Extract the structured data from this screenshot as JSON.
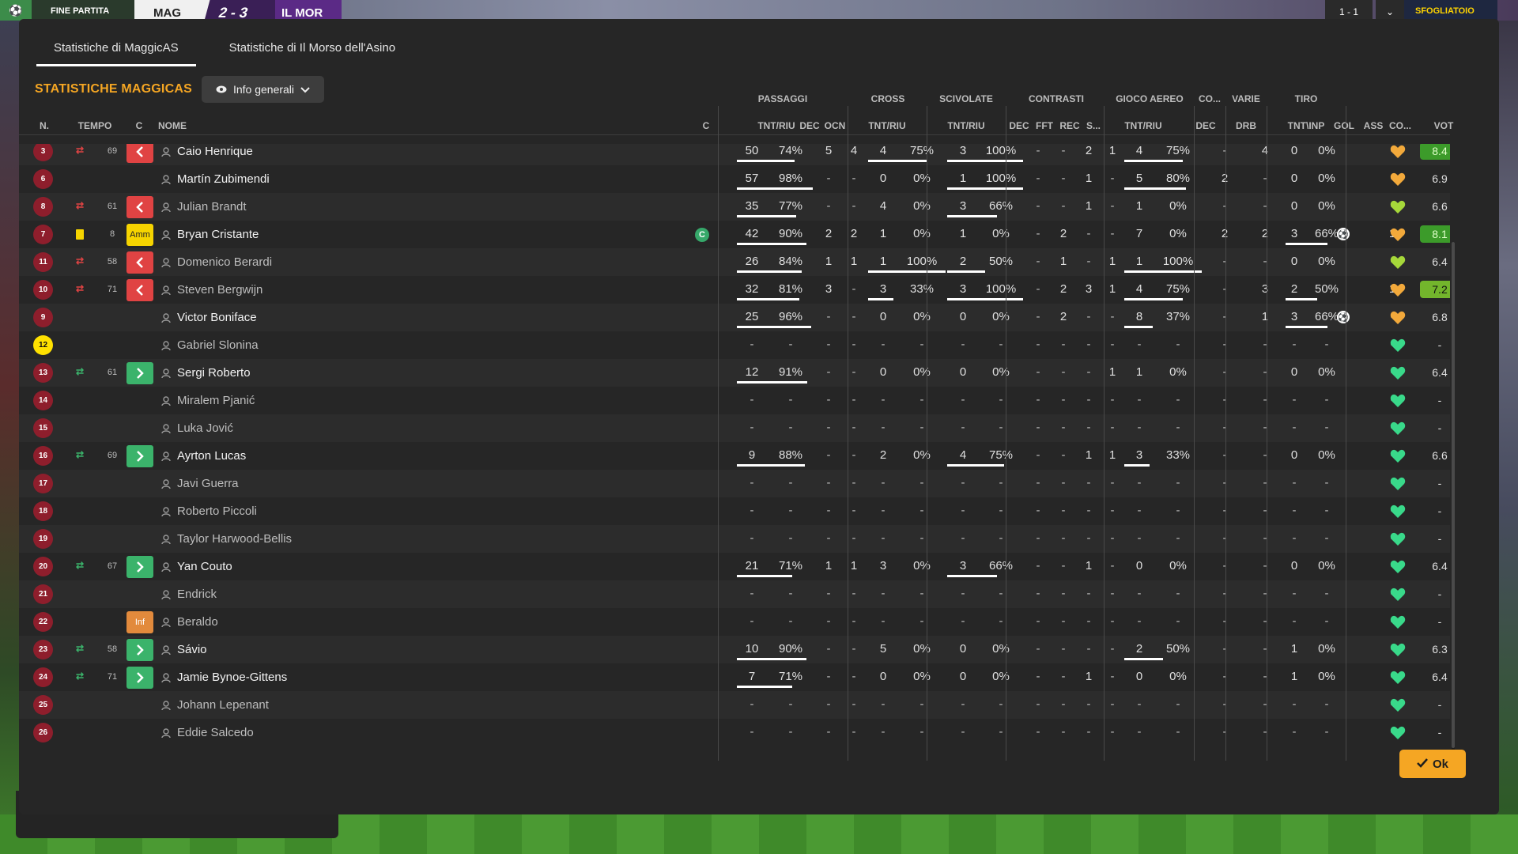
{
  "topbar": {
    "fine_partita": "FINE PARTITA",
    "home_abbr": "MAG",
    "score": "2 - 3",
    "away_abbr": "IL MOR",
    "right_score": "1 - 1",
    "right_label": "SFOGLIATOIO"
  },
  "tabs": [
    {
      "label": "Statistiche di MaggicAS",
      "active": true
    },
    {
      "label": "Statistiche di Il Morso dell'Asino",
      "active": false
    }
  ],
  "title": "STATISTICHE MAGGICAS",
  "view_dropdown": "Info generali",
  "group_headers": {
    "passaggi": "PASSAGGI",
    "cross": "CROSS",
    "scivolate": "SCIVOLATE",
    "contrasti": "CONTRASTI",
    "gioco_aereo": "GIOCO AEREO",
    "co": "CO...",
    "varie": "VARIE",
    "tiro": "TIRO"
  },
  "columns": {
    "n": "N.",
    "tempo": "TEMPO",
    "c": "C",
    "nome": "NOME",
    "capt": "C",
    "pass_tntriu": "TNT/RIU",
    "pass_dec": "DEC",
    "pass_ocn": "OCN",
    "cross_tntriu": "TNT/RIU",
    "sciv_tntriu": "TNT/RIU",
    "contr_dec": "DEC",
    "contr_fft": "FFT",
    "contr_rec": "REC",
    "contr_s": "S...",
    "aereo_tntriu": "TNT/RIU",
    "co_dec": "DEC",
    "varie_drb": "DRB",
    "tiro_tntinp": "TNT\\INP",
    "gol": "GOL",
    "ass": "ASS",
    "co": "CO...",
    "vot": "VOT"
  },
  "players": [
    {
      "n": "3",
      "sub": "out",
      "min": "69",
      "cond": "out",
      "name": "Caio Henrique",
      "played": true,
      "pass": [
        "50",
        "74%"
      ],
      "pdec": "5",
      "pocn": "4",
      "cross": [
        "4",
        "75%"
      ],
      "sciv": [
        "3",
        "100%"
      ],
      "cdec": "-",
      "cfft": "-",
      "crec": "2",
      "cs": "1",
      "aereo": [
        "4",
        "75%"
      ],
      "codec": "-",
      "drb": "4",
      "tiro": [
        "0",
        "0%"
      ],
      "gol": "",
      "ass": "-",
      "heart": "orange",
      "vote": "8.4",
      "vote_style": "hi"
    },
    {
      "n": "6",
      "sub": "",
      "min": "",
      "cond": "",
      "name": "Martín Zubimendi",
      "played": true,
      "pass": [
        "57",
        "98%"
      ],
      "pdec": "-",
      "pocn": "-",
      "cross": [
        "0",
        "0%"
      ],
      "sciv": [
        "1",
        "100%"
      ],
      "cdec": "-",
      "cfft": "-",
      "crec": "1",
      "cs": "-",
      "aereo": [
        "5",
        "80%"
      ],
      "codec": "2",
      "drb": "-",
      "tiro": [
        "0",
        "0%"
      ],
      "gol": "",
      "ass": "-",
      "heart": "orange",
      "vote": "6.9",
      "vote_style": ""
    },
    {
      "n": "8",
      "sub": "out",
      "min": "61",
      "cond": "out",
      "name": "Julian Brandt",
      "played": false,
      "pass": [
        "35",
        "77%"
      ],
      "pdec": "-",
      "pocn": "-",
      "cross": [
        "4",
        "0%"
      ],
      "sciv": [
        "3",
        "66%"
      ],
      "cdec": "-",
      "cfft": "-",
      "crec": "1",
      "cs": "-",
      "aereo": [
        "1",
        "0%"
      ],
      "codec": "-",
      "drb": "-",
      "tiro": [
        "0",
        "0%"
      ],
      "gol": "",
      "ass": "-",
      "heart": "lime",
      "vote": "6.6",
      "vote_style": ""
    },
    {
      "n": "7",
      "sub": "yc",
      "min": "8",
      "cond": "amm",
      "name": "Bryan Cristante",
      "played": true,
      "capt": "C",
      "pass": [
        "42",
        "90%"
      ],
      "pdec": "2",
      "pocn": "2",
      "cross": [
        "1",
        "0%"
      ],
      "sciv": [
        "1",
        "0%"
      ],
      "cdec": "-",
      "cfft": "2",
      "crec": "-",
      "cs": "-",
      "aereo": [
        "7",
        "0%"
      ],
      "codec": "2",
      "drb": "2",
      "tiro": [
        "3",
        "66%"
      ],
      "gol": "1",
      "ass": "1",
      "heart": "orange",
      "vote": "8.1",
      "vote_style": "hi"
    },
    {
      "n": "11",
      "sub": "out",
      "min": "58",
      "cond": "out",
      "name": "Domenico Berardi",
      "played": false,
      "pass": [
        "26",
        "84%"
      ],
      "pdec": "1",
      "pocn": "1",
      "cross": [
        "1",
        "100%"
      ],
      "sciv": [
        "2",
        "50%"
      ],
      "cdec": "-",
      "cfft": "1",
      "crec": "-",
      "cs": "1",
      "aereo": [
        "1",
        "100%"
      ],
      "codec": "-",
      "drb": "-",
      "tiro": [
        "0",
        "0%"
      ],
      "gol": "",
      "ass": "-",
      "heart": "lime",
      "vote": "6.4",
      "vote_style": ""
    },
    {
      "n": "10",
      "sub": "out",
      "min": "71",
      "cond": "out",
      "name": "Steven Bergwijn",
      "played": false,
      "pass": [
        "32",
        "81%"
      ],
      "pdec": "3",
      "pocn": "-",
      "cross": [
        "3",
        "33%"
      ],
      "sciv": [
        "3",
        "100%"
      ],
      "cdec": "-",
      "cfft": "2",
      "crec": "3",
      "cs": "1",
      "aereo": [
        "4",
        "75%"
      ],
      "codec": "-",
      "drb": "3",
      "tiro": [
        "2",
        "50%"
      ],
      "gol": "",
      "ass": "1",
      "heart": "orange",
      "vote": "7.2",
      "vote_style": "mid"
    },
    {
      "n": "9",
      "sub": "",
      "min": "",
      "cond": "",
      "name": "Victor Boniface",
      "played": true,
      "pass": [
        "25",
        "96%"
      ],
      "pdec": "-",
      "pocn": "-",
      "cross": [
        "0",
        "0%"
      ],
      "sciv": [
        "0",
        "0%"
      ],
      "cdec": "-",
      "cfft": "2",
      "crec": "-",
      "cs": "-",
      "aereo": [
        "8",
        "37%"
      ],
      "codec": "-",
      "drb": "1",
      "tiro": [
        "3",
        "66%"
      ],
      "gol": "1",
      "ass": "-",
      "heart": "orange",
      "vote": "6.8",
      "vote_style": ""
    },
    {
      "n": "12",
      "sub": "",
      "min": "",
      "cond": "",
      "name": "Gabriel Slonina",
      "played": false,
      "gk": true,
      "pass": [
        "-",
        "-"
      ],
      "pdec": "-",
      "pocn": "-",
      "cross": [
        "-",
        "-"
      ],
      "sciv": [
        "-",
        "-"
      ],
      "cdec": "-",
      "cfft": "-",
      "crec": "-",
      "cs": "-",
      "aereo": [
        "-",
        "-"
      ],
      "codec": "-",
      "drb": "-",
      "tiro": [
        "-",
        "-"
      ],
      "gol": "",
      "ass": "-",
      "heart": "green",
      "vote": "-",
      "vote_style": ""
    },
    {
      "n": "13",
      "sub": "in",
      "min": "61",
      "cond": "in",
      "name": "Sergi Roberto",
      "played": true,
      "pass": [
        "12",
        "91%"
      ],
      "pdec": "-",
      "pocn": "-",
      "cross": [
        "0",
        "0%"
      ],
      "sciv": [
        "0",
        "0%"
      ],
      "cdec": "-",
      "cfft": "-",
      "crec": "-",
      "cs": "1",
      "aereo": [
        "1",
        "0%"
      ],
      "codec": "-",
      "drb": "-",
      "tiro": [
        "0",
        "0%"
      ],
      "gol": "",
      "ass": "-",
      "heart": "green",
      "vote": "6.4",
      "vote_style": ""
    },
    {
      "n": "14",
      "sub": "",
      "min": "",
      "cond": "",
      "name": "Miralem Pjanić",
      "played": false,
      "pass": [
        "-",
        "-"
      ],
      "pdec": "-",
      "pocn": "-",
      "cross": [
        "-",
        "-"
      ],
      "sciv": [
        "-",
        "-"
      ],
      "cdec": "-",
      "cfft": "-",
      "crec": "-",
      "cs": "-",
      "aereo": [
        "-",
        "-"
      ],
      "codec": "-",
      "drb": "-",
      "tiro": [
        "-",
        "-"
      ],
      "gol": "",
      "ass": "-",
      "heart": "green",
      "vote": "-",
      "vote_style": ""
    },
    {
      "n": "15",
      "sub": "",
      "min": "",
      "cond": "",
      "name": "Luka Jović",
      "played": false,
      "pass": [
        "-",
        "-"
      ],
      "pdec": "-",
      "pocn": "-",
      "cross": [
        "-",
        "-"
      ],
      "sciv": [
        "-",
        "-"
      ],
      "cdec": "-",
      "cfft": "-",
      "crec": "-",
      "cs": "-",
      "aereo": [
        "-",
        "-"
      ],
      "codec": "-",
      "drb": "-",
      "tiro": [
        "-",
        "-"
      ],
      "gol": "",
      "ass": "-",
      "heart": "green",
      "vote": "-",
      "vote_style": ""
    },
    {
      "n": "16",
      "sub": "in",
      "min": "69",
      "cond": "in",
      "name": "Ayrton Lucas",
      "played": true,
      "pass": [
        "9",
        "88%"
      ],
      "pdec": "-",
      "pocn": "-",
      "cross": [
        "2",
        "0%"
      ],
      "sciv": [
        "4",
        "75%"
      ],
      "cdec": "-",
      "cfft": "-",
      "crec": "1",
      "cs": "1",
      "aereo": [
        "3",
        "33%"
      ],
      "codec": "-",
      "drb": "-",
      "tiro": [
        "0",
        "0%"
      ],
      "gol": "",
      "ass": "-",
      "heart": "green",
      "vote": "6.6",
      "vote_style": ""
    },
    {
      "n": "17",
      "sub": "",
      "min": "",
      "cond": "",
      "name": "Javi Guerra",
      "played": false,
      "pass": [
        "-",
        "-"
      ],
      "pdec": "-",
      "pocn": "-",
      "cross": [
        "-",
        "-"
      ],
      "sciv": [
        "-",
        "-"
      ],
      "cdec": "-",
      "cfft": "-",
      "crec": "-",
      "cs": "-",
      "aereo": [
        "-",
        "-"
      ],
      "codec": "-",
      "drb": "-",
      "tiro": [
        "-",
        "-"
      ],
      "gol": "",
      "ass": "-",
      "heart": "green",
      "vote": "-",
      "vote_style": ""
    },
    {
      "n": "18",
      "sub": "",
      "min": "",
      "cond": "",
      "name": "Roberto Piccoli",
      "played": false,
      "pass": [
        "-",
        "-"
      ],
      "pdec": "-",
      "pocn": "-",
      "cross": [
        "-",
        "-"
      ],
      "sciv": [
        "-",
        "-"
      ],
      "cdec": "-",
      "cfft": "-",
      "crec": "-",
      "cs": "-",
      "aereo": [
        "-",
        "-"
      ],
      "codec": "-",
      "drb": "-",
      "tiro": [
        "-",
        "-"
      ],
      "gol": "",
      "ass": "-",
      "heart": "green",
      "vote": "-",
      "vote_style": ""
    },
    {
      "n": "19",
      "sub": "",
      "min": "",
      "cond": "",
      "name": "Taylor Harwood-Bellis",
      "played": false,
      "pass": [
        "-",
        "-"
      ],
      "pdec": "-",
      "pocn": "-",
      "cross": [
        "-",
        "-"
      ],
      "sciv": [
        "-",
        "-"
      ],
      "cdec": "-",
      "cfft": "-",
      "crec": "-",
      "cs": "-",
      "aereo": [
        "-",
        "-"
      ],
      "codec": "-",
      "drb": "-",
      "tiro": [
        "-",
        "-"
      ],
      "gol": "",
      "ass": "-",
      "heart": "green",
      "vote": "-",
      "vote_style": ""
    },
    {
      "n": "20",
      "sub": "in",
      "min": "67",
      "cond": "in",
      "name": "Yan Couto",
      "played": true,
      "pass": [
        "21",
        "71%"
      ],
      "pdec": "1",
      "pocn": "1",
      "cross": [
        "3",
        "0%"
      ],
      "sciv": [
        "3",
        "66%"
      ],
      "cdec": "-",
      "cfft": "-",
      "crec": "1",
      "cs": "-",
      "aereo": [
        "0",
        "0%"
      ],
      "codec": "-",
      "drb": "-",
      "tiro": [
        "0",
        "0%"
      ],
      "gol": "",
      "ass": "-",
      "heart": "green",
      "vote": "6.4",
      "vote_style": ""
    },
    {
      "n": "21",
      "sub": "",
      "min": "",
      "cond": "",
      "name": "Endrick",
      "played": false,
      "pass": [
        "-",
        "-"
      ],
      "pdec": "-",
      "pocn": "-",
      "cross": [
        "-",
        "-"
      ],
      "sciv": [
        "-",
        "-"
      ],
      "cdec": "-",
      "cfft": "-",
      "crec": "-",
      "cs": "-",
      "aereo": [
        "-",
        "-"
      ],
      "codec": "-",
      "drb": "-",
      "tiro": [
        "-",
        "-"
      ],
      "gol": "",
      "ass": "-",
      "heart": "green",
      "vote": "-",
      "vote_style": ""
    },
    {
      "n": "22",
      "sub": "",
      "min": "",
      "cond": "inf",
      "name": "Beraldo",
      "played": false,
      "pass": [
        "-",
        "-"
      ],
      "pdec": "-",
      "pocn": "-",
      "cross": [
        "-",
        "-"
      ],
      "sciv": [
        "-",
        "-"
      ],
      "cdec": "-",
      "cfft": "-",
      "crec": "-",
      "cs": "-",
      "aereo": [
        "-",
        "-"
      ],
      "codec": "-",
      "drb": "-",
      "tiro": [
        "-",
        "-"
      ],
      "gol": "",
      "ass": "-",
      "heart": "green",
      "vote": "-",
      "vote_style": ""
    },
    {
      "n": "23",
      "sub": "in",
      "min": "58",
      "cond": "in",
      "name": "Sávio",
      "played": true,
      "pass": [
        "10",
        "90%"
      ],
      "pdec": "-",
      "pocn": "-",
      "cross": [
        "5",
        "0%"
      ],
      "sciv": [
        "0",
        "0%"
      ],
      "cdec": "-",
      "cfft": "-",
      "crec": "-",
      "cs": "-",
      "aereo": [
        "2",
        "50%"
      ],
      "codec": "-",
      "drb": "-",
      "tiro": [
        "1",
        "0%"
      ],
      "gol": "",
      "ass": "-",
      "heart": "green",
      "vote": "6.3",
      "vote_style": ""
    },
    {
      "n": "24",
      "sub": "in",
      "min": "71",
      "cond": "in",
      "name": "Jamie Bynoe-Gittens",
      "played": true,
      "pass": [
        "7",
        "71%"
      ],
      "pdec": "-",
      "pocn": "-",
      "cross": [
        "0",
        "0%"
      ],
      "sciv": [
        "0",
        "0%"
      ],
      "cdec": "-",
      "cfft": "-",
      "crec": "1",
      "cs": "-",
      "aereo": [
        "0",
        "0%"
      ],
      "codec": "-",
      "drb": "-",
      "tiro": [
        "1",
        "0%"
      ],
      "gol": "",
      "ass": "-",
      "heart": "green",
      "vote": "6.4",
      "vote_style": ""
    },
    {
      "n": "25",
      "sub": "",
      "min": "",
      "cond": "",
      "name": "Johann Lepenant",
      "played": false,
      "pass": [
        "-",
        "-"
      ],
      "pdec": "-",
      "pocn": "-",
      "cross": [
        "-",
        "-"
      ],
      "sciv": [
        "-",
        "-"
      ],
      "cdec": "-",
      "cfft": "-",
      "crec": "-",
      "cs": "-",
      "aereo": [
        "-",
        "-"
      ],
      "codec": "-",
      "drb": "-",
      "tiro": [
        "-",
        "-"
      ],
      "gol": "",
      "ass": "-",
      "heart": "green",
      "vote": "-",
      "vote_style": ""
    },
    {
      "n": "26",
      "sub": "",
      "min": "",
      "cond": "",
      "name": "Eddie Salcedo",
      "played": false,
      "pass": [
        "-",
        "-"
      ],
      "pdec": "-",
      "pocn": "-",
      "cross": [
        "-",
        "-"
      ],
      "sciv": [
        "-",
        "-"
      ],
      "cdec": "-",
      "cfft": "-",
      "crec": "-",
      "cs": "-",
      "aereo": [
        "-",
        "-"
      ],
      "codec": "-",
      "drb": "-",
      "tiro": [
        "-",
        "-"
      ],
      "gol": "",
      "ass": "-",
      "heart": "green",
      "vote": "-",
      "vote_style": ""
    }
  ],
  "ok_label": "Ok",
  "colors": {
    "accent": "#f5a623",
    "shirt": "#8e1e2c",
    "gk_shirt": "#ffe100",
    "sub_out": "#e04343",
    "sub_in": "#3bb36b",
    "heart_orange": "#f2a93b",
    "heart_lime": "#a6d83a",
    "heart_green": "#39d98a",
    "vote_hi": "#3c9b2a",
    "vote_mid": "#73b52c"
  }
}
